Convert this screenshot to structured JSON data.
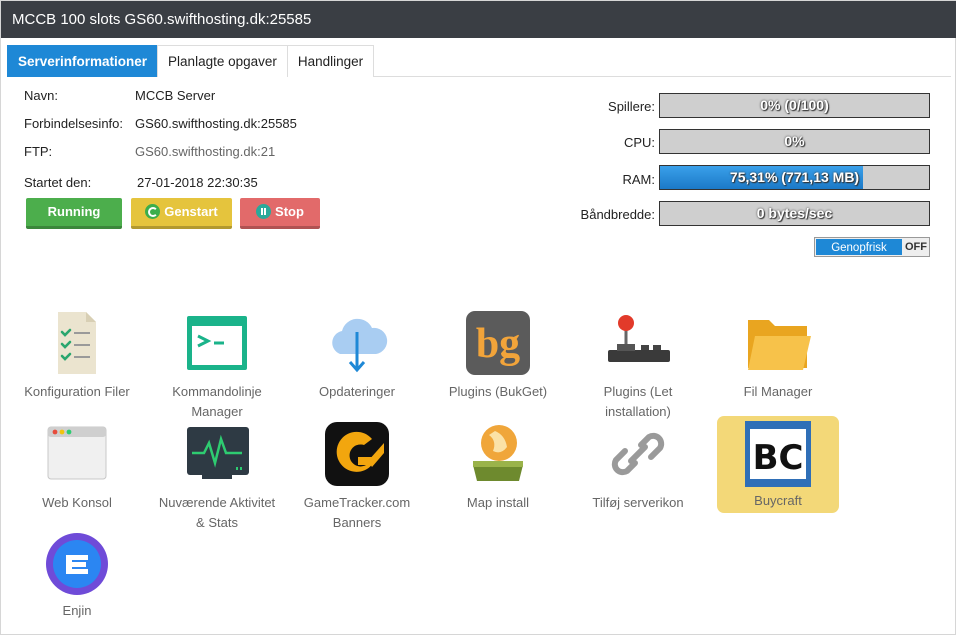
{
  "window": {
    "title": "MCCB 100 slots GS60.swifthosting.dk:25585"
  },
  "tabs": [
    {
      "label": "Serverinformationer",
      "active": true
    },
    {
      "label": "Planlagte opgaver",
      "active": false
    },
    {
      "label": "Handlinger",
      "active": false
    }
  ],
  "info": {
    "name_label": "Navn:",
    "name_value": "MCCB Server",
    "conn_label": "Forbindelsesinfo:",
    "conn_value": "GS60.swifthosting.dk:25585",
    "ftp_label": "FTP:",
    "ftp_value": "GS60.swifthosting.dk:21",
    "started_label": "Startet den:",
    "started_value": "27-01-2018 22:30:35"
  },
  "controls": {
    "running": "Running",
    "restart": "Genstart",
    "stop": "Stop"
  },
  "stats": {
    "players": {
      "label": "Spillere:",
      "text": "0% (0/100)",
      "percent": 0
    },
    "cpu": {
      "label": "CPU:",
      "text": "0%",
      "percent": 0
    },
    "ram": {
      "label": "RAM:",
      "text": "75,31% (771,13 MB)",
      "percent": 75.31
    },
    "bandwidth": {
      "label": "Båndbredde:",
      "text": "0 bytes/sec",
      "percent": 0
    }
  },
  "refresh_toggle": {
    "on_label": "Genopfrisk",
    "off_label": "OFF"
  },
  "apps": [
    {
      "label": "Konfiguration Filer",
      "icon": "config-files-icon"
    },
    {
      "label": "Kommandolinje Manager",
      "icon": "terminal-icon"
    },
    {
      "label": "Opdateringer",
      "icon": "cloud-download-icon"
    },
    {
      "label": "Plugins (BukGet)",
      "icon": "bukget-icon",
      "icon_text": "bg"
    },
    {
      "label": "Plugins (Let installation)",
      "icon": "joystick-icon"
    },
    {
      "label": "Fil Manager",
      "icon": "folder-icon"
    },
    {
      "label": "Web Konsol",
      "icon": "browser-window-icon"
    },
    {
      "label": "Nuværende Aktivitet & Stats",
      "icon": "activity-monitor-icon"
    },
    {
      "label": "GameTracker.com Banners",
      "icon": "gametracker-icon"
    },
    {
      "label": "Map install",
      "icon": "globe-drive-icon"
    },
    {
      "label": "Tilføj serverikon",
      "icon": "link-icon"
    },
    {
      "label": "Buycraft",
      "icon": "buycraft-icon",
      "icon_text": "BC"
    },
    {
      "label": "Enjin",
      "icon": "enjin-icon"
    }
  ],
  "colors": {
    "accent": "#1e88d6",
    "running": "#4cae4c",
    "restart": "#e5c43d",
    "stop": "#e26a6a",
    "titlebar": "#3a3e44"
  }
}
